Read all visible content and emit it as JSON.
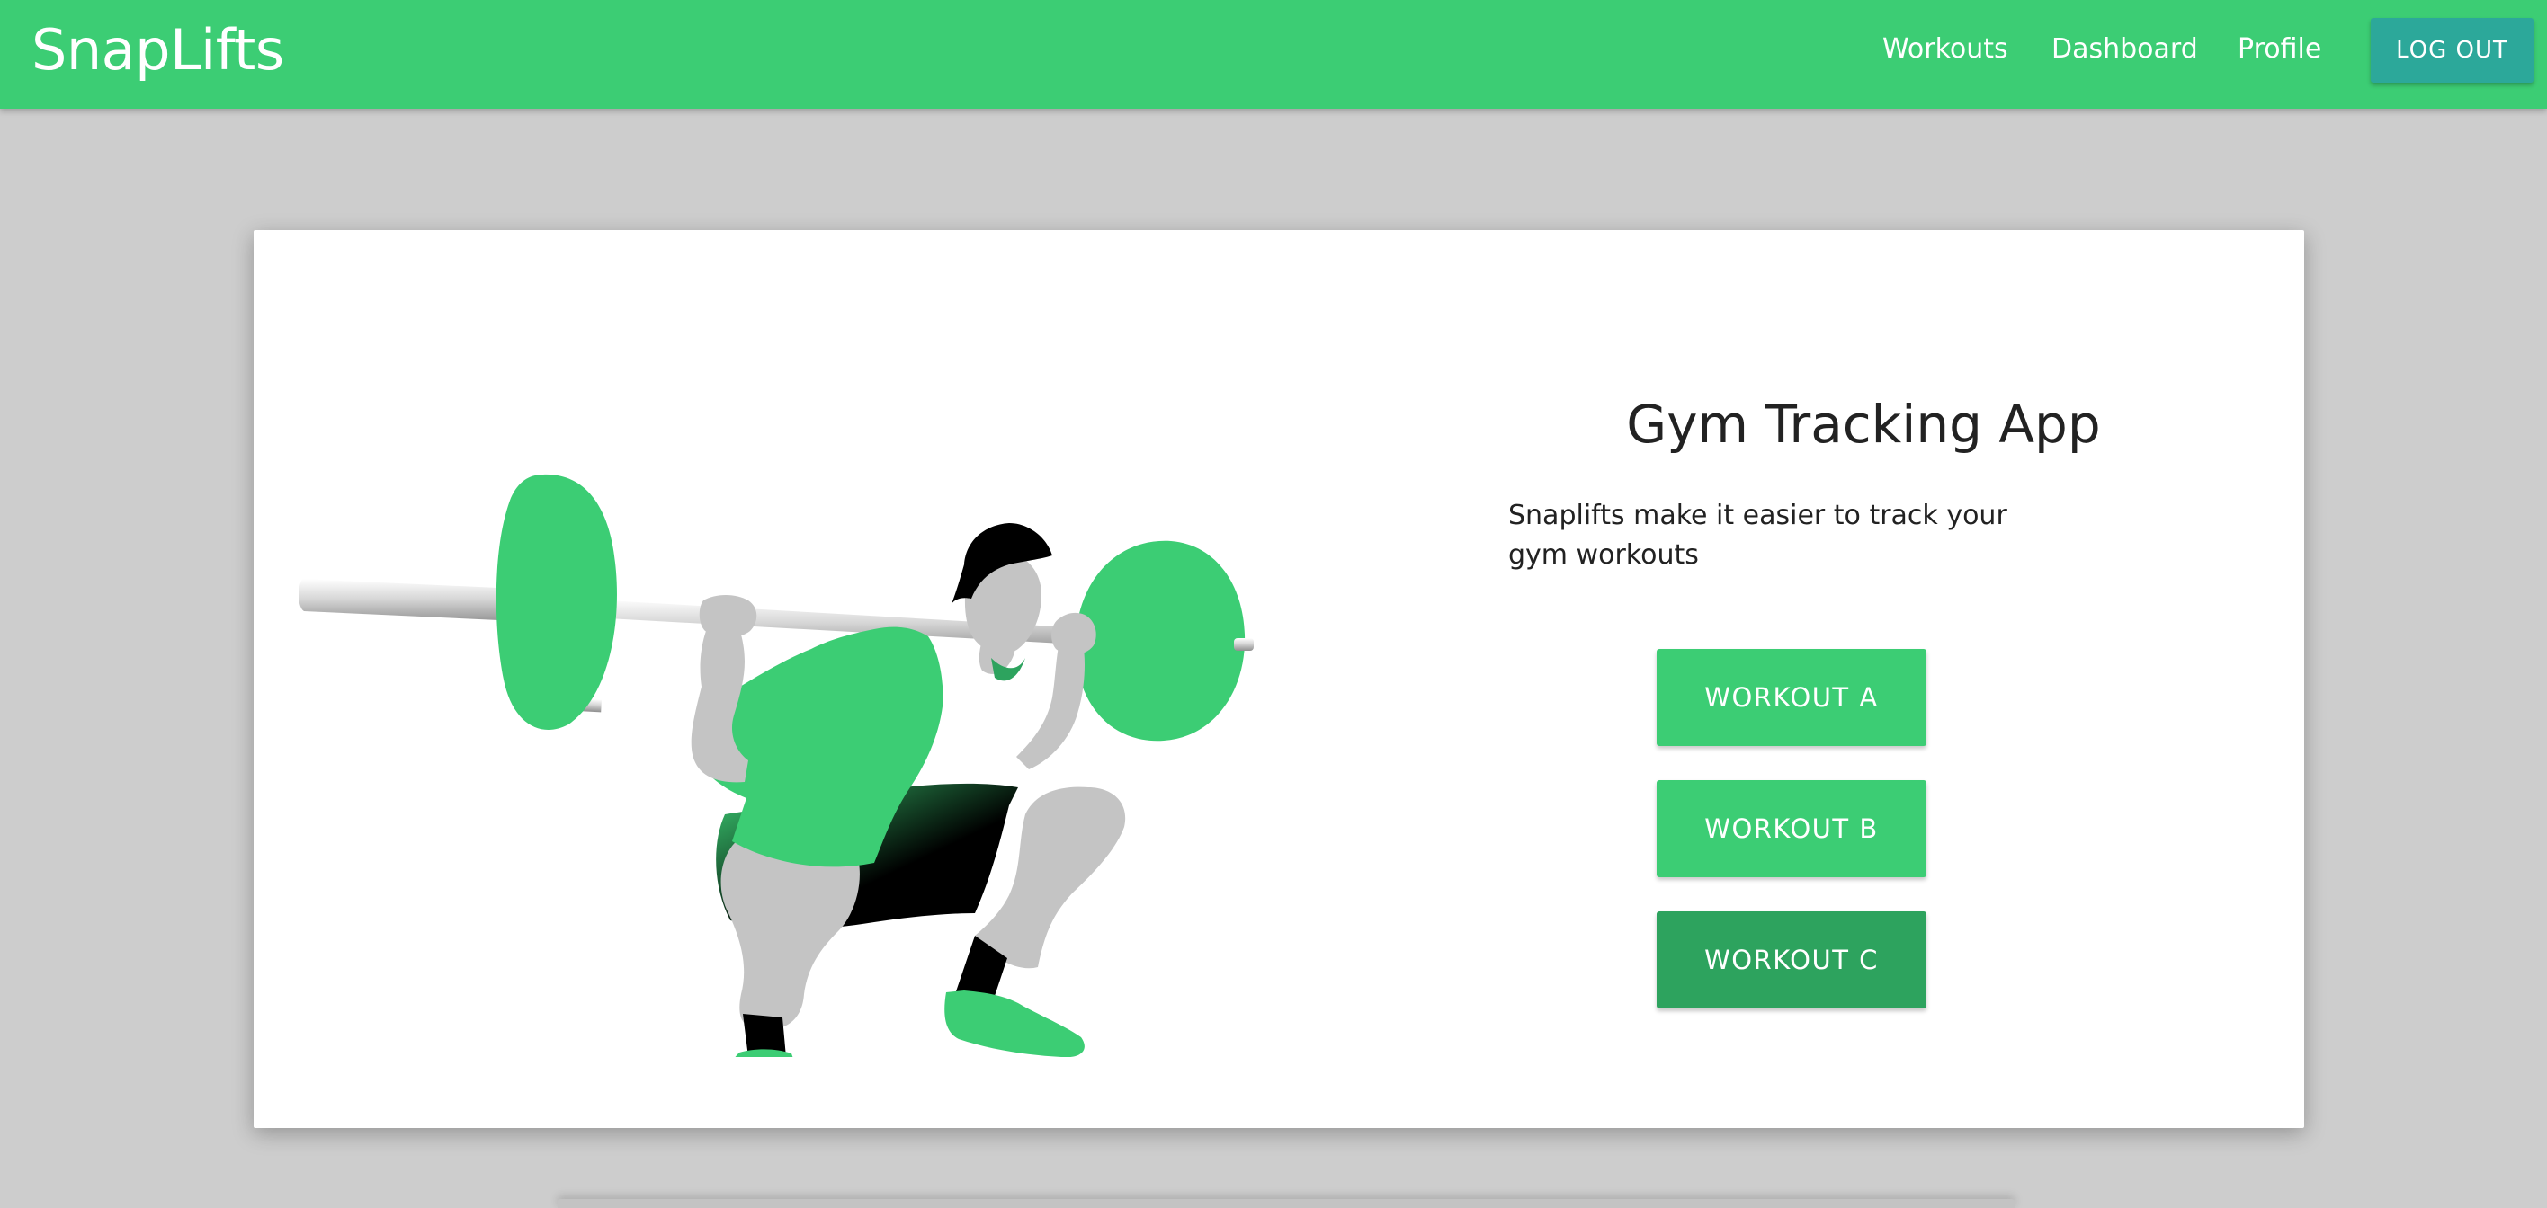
{
  "colors": {
    "primary": "#3ccd74",
    "primary_dark": "#2da35e",
    "accent": "#2ca89a",
    "background": "#cdcdcd",
    "card": "#ffffff"
  },
  "navbar": {
    "brand": "SnapLifts",
    "links": [
      "Workouts",
      "Dashboard",
      "Profile"
    ],
    "logout_label": "LOG OUT"
  },
  "hero": {
    "title": "Gym Tracking App",
    "description": "Snaplifts make it easier to track your gym workouts",
    "illustration": "person-squatting-barbell-illustration"
  },
  "workouts": {
    "buttons": [
      "WORKOUT A",
      "WORKOUT B",
      "WORKOUT C"
    ]
  }
}
